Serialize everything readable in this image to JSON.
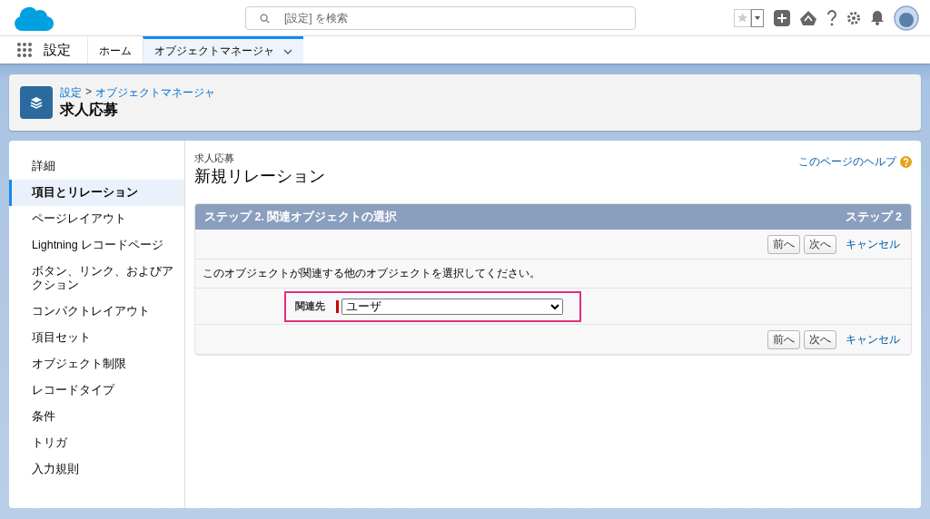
{
  "header": {
    "search": {
      "placeholder": "[設定] を検索"
    }
  },
  "nav": {
    "app_name": "設定",
    "tabs": [
      {
        "label": "ホーム",
        "selected": false,
        "dropdown": false
      },
      {
        "label": "オブジェクトマネージャ",
        "selected": true,
        "dropdown": true
      }
    ]
  },
  "page_header": {
    "breadcrumb": [
      {
        "label": "設定"
      },
      {
        "label": "オブジェクトマネージャ"
      }
    ],
    "separator": ">",
    "title": "求人応募"
  },
  "sidebar": {
    "items": [
      {
        "label": "詳細",
        "selected": false
      },
      {
        "label": "項目とリレーション",
        "selected": true
      },
      {
        "label": "ページレイアウト",
        "selected": false
      },
      {
        "label": "Lightning レコードページ",
        "selected": false
      },
      {
        "label": "ボタン、リンク、およびアクション",
        "selected": false
      },
      {
        "label": "コンパクトレイアウト",
        "selected": false
      },
      {
        "label": "項目セット",
        "selected": false
      },
      {
        "label": "オブジェクト制限",
        "selected": false
      },
      {
        "label": "レコードタイプ",
        "selected": false
      },
      {
        "label": "条件",
        "selected": false
      },
      {
        "label": "トリガ",
        "selected": false
      },
      {
        "label": "入力規則",
        "selected": false
      }
    ]
  },
  "content": {
    "object_label": "求人応募",
    "title": "新規リレーション",
    "help_link": "このページのヘルプ",
    "step": {
      "title": "ステップ 2. 関連オブジェクトの選択",
      "step_label": "ステップ 2",
      "top_buttons": [
        {
          "label": "前へ",
          "kind": "button"
        },
        {
          "label": "次へ",
          "kind": "button"
        },
        {
          "label": "キャンセル",
          "kind": "link"
        }
      ],
      "instruction": "このオブジェクトが関連する他のオブジェクトを選択してください。",
      "field": {
        "label": "関連先",
        "value": "ユーザ",
        "required": true,
        "highlighted": true
      },
      "bottom_buttons": [
        {
          "label": "前へ",
          "kind": "button"
        },
        {
          "label": "次へ",
          "kind": "button"
        },
        {
          "label": "キャンセル",
          "kind": "link"
        }
      ]
    }
  }
}
